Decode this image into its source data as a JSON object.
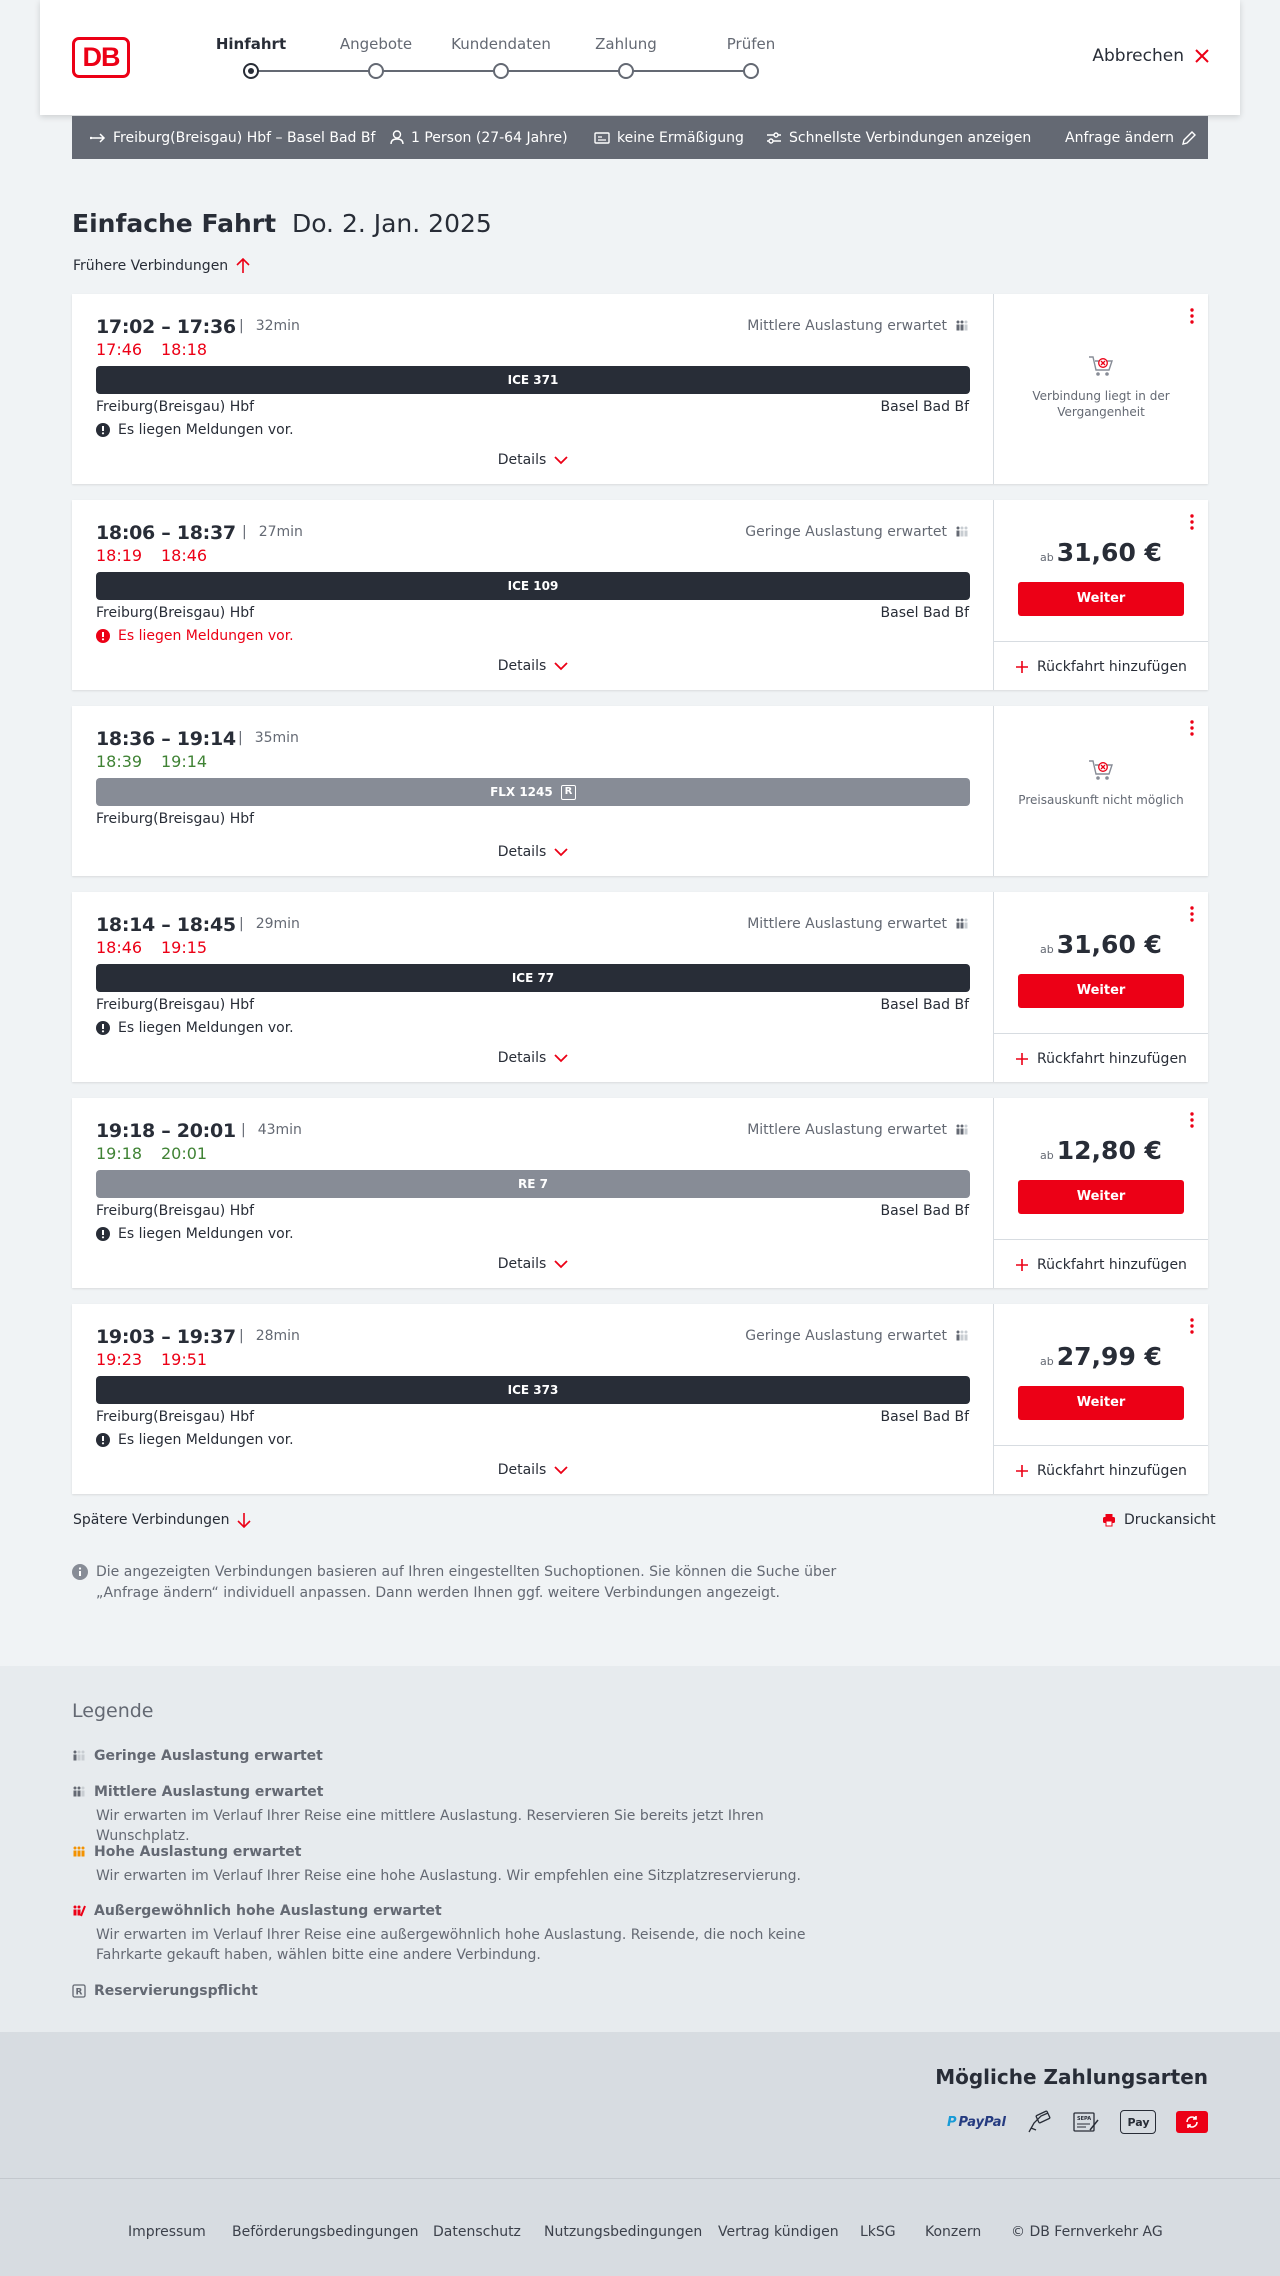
{
  "header": {
    "logo": "DB",
    "steps": [
      "Hinfahrt",
      "Angebote",
      "Kundendaten",
      "Zahlung",
      "Prüfen"
    ],
    "active_step": 0,
    "cancel_label": "Abbrechen"
  },
  "summary": {
    "route": "Freiburg(Breisgau) Hbf – Basel Bad Bf",
    "passengers": "1 Person (27-64 Jahre)",
    "discount": "keine Ermäßigung",
    "filter": "Schnellste Verbindungen anzeigen",
    "change": "Anfrage ändern"
  },
  "title": {
    "type": "Einfache Fahrt",
    "date": "Do. 2. Jan. 2025"
  },
  "earlier_label": "Frühere Verbindungen",
  "later_label": "Spätere Verbindungen",
  "print_label": "Druckansicht",
  "details_label": "Details",
  "weiter_label": "Weiter",
  "return_label": "Rückfahrt hinzufügen",
  "price_prefix": "ab",
  "connections": [
    {
      "times": "17:02 – 17:36",
      "duration": "32min",
      "rt_dep": "17:46",
      "rt_arr": "18:18",
      "rt_color": "red",
      "load": "Mittlere Auslastung erwartet",
      "train": "ICE 371",
      "from": "Freiburg(Breisgau) Hbf",
      "to": "Basel Bad Bf",
      "message": "Es liegen Meldungen vor.",
      "message_color": "black",
      "unavailable": "Verbindung liegt in der Vergangenheit"
    },
    {
      "times": "18:06 – 18:37",
      "duration": "27min",
      "rt_dep": "18:19",
      "rt_arr": "18:46",
      "rt_color": "red",
      "load": "Geringe Auslastung erwartet",
      "train": "ICE 109",
      "from": "Freiburg(Breisgau) Hbf",
      "to": "Basel Bad Bf",
      "message": "Es liegen Meldungen vor.",
      "message_color": "red",
      "price": "31,60 €"
    },
    {
      "times": "18:36 – 19:14",
      "duration": "35min",
      "rt_dep": "18:39",
      "rt_arr": "19:14",
      "rt_color": "green",
      "train": "FLX 1245",
      "train_badge": "R",
      "from": "Freiburg(Breisgau) Hbf",
      "to": "",
      "unavailable": "Preisauskunft nicht möglich"
    },
    {
      "times": "18:14 – 18:45",
      "duration": "29min",
      "rt_dep": "18:46",
      "rt_arr": "19:15",
      "rt_color": "red",
      "load": "Mittlere Auslastung erwartet",
      "train": "ICE 77",
      "from": "Freiburg(Breisgau) Hbf",
      "to": "Basel Bad Bf",
      "message": "Es liegen Meldungen vor.",
      "message_color": "black",
      "price": "31,60 €"
    },
    {
      "times": "19:18 – 20:01",
      "duration": "43min",
      "rt_dep": "19:18",
      "rt_arr": "20:01",
      "rt_color": "green",
      "load": "Mittlere Auslastung erwartet",
      "train": "RE 7",
      "from": "Freiburg(Breisgau) Hbf",
      "to": "Basel Bad Bf",
      "message": "Es liegen Meldungen vor.",
      "message_color": "black",
      "price": "12,80 €"
    },
    {
      "times": "19:03 – 19:37",
      "duration": "28min",
      "rt_dep": "19:23",
      "rt_arr": "19:51",
      "rt_color": "red",
      "load": "Geringe Auslastung erwartet",
      "train": "ICE 373",
      "from": "Freiburg(Breisgau) Hbf",
      "to": "Basel Bad Bf",
      "message": "Es liegen Meldungen vor.",
      "message_color": "black",
      "price": "27,99 €"
    }
  ],
  "info_text": "Die angezeigten Verbindungen basieren auf Ihren eingestellten Suchoptionen. Sie können die Suche über „Anfrage ändern“ individuell anpassen. Dann werden Ihnen ggf. weitere Verbindungen angezeigt.",
  "legend": {
    "title": "Legende",
    "items": [
      {
        "title": "Geringe Auslastung erwartet",
        "desc": ""
      },
      {
        "title": "Mittlere Auslastung erwartet",
        "desc": "Wir erwarten im Verlauf Ihrer Reise eine mittlere Auslastung. Reservieren Sie bereits jetzt Ihren Wunschplatz."
      },
      {
        "title": "Hohe Auslastung erwartet",
        "desc": "Wir erwarten im Verlauf Ihrer Reise eine hohe Auslastung. Wir empfehlen eine Sitzplatzreservierung."
      },
      {
        "title": "Außergewöhnlich hohe Auslastung erwartet",
        "desc": "Wir erwarten im Verlauf Ihrer Reise eine außergewöhnlich hohe Auslastung. Reisende, die noch keine Fahrkarte gekauft haben, wählen bitte eine andere Verbindung."
      },
      {
        "title": "Reservierungspflicht",
        "desc": ""
      }
    ]
  },
  "payments": {
    "title": "Mögliche Zahlungsarten",
    "paypal": "PayPal",
    "sepa": "SEPA",
    "applepay": "Pay"
  },
  "footer": [
    "Impressum",
    "Beförderungsbedingungen",
    "Datenschutz",
    "Nutzungsbedingungen",
    "Vertrag kündigen",
    "LkSG",
    "Konzern",
    "© DB Fernverkehr AG"
  ],
  "colors": {
    "accent": "#ec0016",
    "dark": "#282d37",
    "grey": "#646973",
    "delay": "#ec0016",
    "ontime": "#408335",
    "hoch": "#f39200"
  }
}
